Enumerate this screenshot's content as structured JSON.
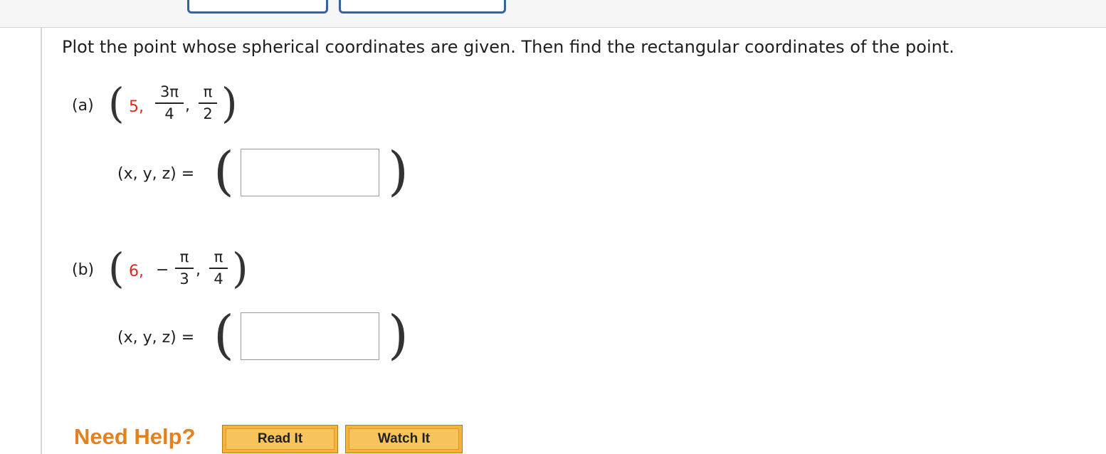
{
  "prompt": "Plot the point whose spherical coordinates are given. Then find the rectangular coordinates of the point.",
  "parts": [
    {
      "label": "(a)",
      "rho": "5,",
      "theta_num": "3π",
      "theta_den": "4",
      "phi_num": "π",
      "phi_den": "2",
      "sep": ",",
      "eq_label": "(x, y, z) =",
      "answer_value": ""
    },
    {
      "label": "(b)",
      "rho": "6,",
      "neg": "−",
      "theta_num": "π",
      "theta_den": "3",
      "phi_num": "π",
      "phi_den": "4",
      "sep": ",",
      "eq_label": "(x, y, z) =",
      "answer_value": ""
    }
  ],
  "help": {
    "title": "Need Help?",
    "read_label": "Read It",
    "watch_label": "Watch It"
  },
  "colors": {
    "given_value": "#d82b1f",
    "need_help": "#e3801f",
    "button_fill": "#f7c45c",
    "tab_border": "#3a6395"
  }
}
